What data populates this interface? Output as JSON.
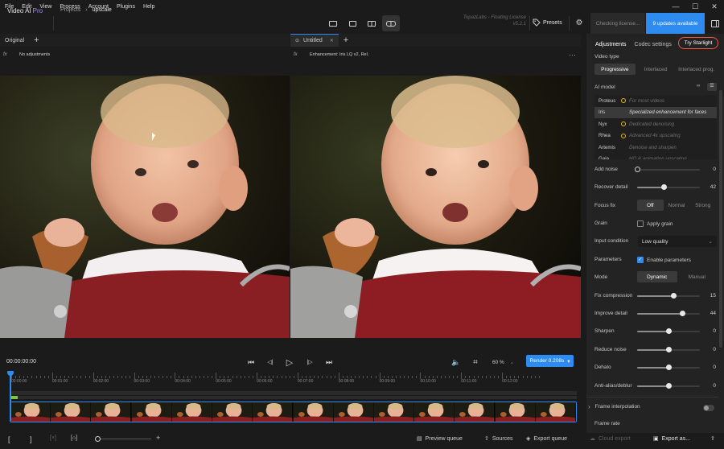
{
  "menu": [
    "File",
    "Edit",
    "View",
    "Process",
    "Account",
    "Plugins",
    "Help"
  ],
  "window_controls": {
    "minimize": "—",
    "maximize": "☐",
    "close": "✕"
  },
  "app": {
    "name": "Video AI",
    "edition": "Pro"
  },
  "breadcrumb": {
    "root": "Projects",
    "sep": "›",
    "current": "upscale"
  },
  "license": {
    "line1": "TopazLabs - Floating License",
    "line2": "v5.2.1"
  },
  "toolbar": {
    "presets_label": "Presets",
    "checking_label": "Checking license...",
    "updates_label": "9 updates available"
  },
  "left_preview": {
    "tab_label": "Original",
    "plus": "+",
    "fx_icon": "fx",
    "subtitle": "No adjustments"
  },
  "right_preview": {
    "tab_label": "Untitled",
    "close": "✕",
    "plus": "+",
    "fx_icon": "fx",
    "subtitle": "Enhancement: Iris LQ v2, Rel.",
    "more": "···"
  },
  "player": {
    "timecode": "00:00:00:00",
    "zoom": "60 %",
    "zoom_caret": "⌄",
    "render_label": "Render 0.208s",
    "render_caret": "▾",
    "icons": {
      "skip_back": "⏮",
      "step_back": "◁|",
      "play": "▷",
      "step_fwd": "|▷",
      "skip_fwd": "⏭",
      "volume": "🔈",
      "crop": "⌗"
    }
  },
  "timeline": {
    "ticks": [
      "00:00:00",
      "00:01:00",
      "00:02:00",
      "00:03:00",
      "00:04:00",
      "00:05:00",
      "00:06:00",
      "00:07:00",
      "00:08:00",
      "00:09:00",
      "00:10:00",
      "00:11:00",
      "00:12:00"
    ],
    "frame_count": 14,
    "progress": 0.014
  },
  "bottombar": {
    "bracket_in": "[",
    "bracket_out": "]",
    "plus": "+",
    "preview_queue": "Preview queue",
    "sources": "Sources",
    "export_queue": "Export queue",
    "cloud_export": "Cloud export",
    "export_as": "Export as...",
    "share": "⇪"
  },
  "panel": {
    "tabs": [
      "Adjustments",
      "Codec settings"
    ],
    "starlight_label": "Try Starlight",
    "video_type": {
      "label": "Video type",
      "options": [
        "Progressive",
        "Interlaced",
        "Interlaced prog."
      ],
      "selected": 0
    },
    "ai_model": {
      "label": "AI model",
      "models": [
        {
          "name": "Proteus",
          "desc": "For most videos",
          "dot": true
        },
        {
          "name": "Iris",
          "desc": "Specialized enhancement for faces",
          "dot": false
        },
        {
          "name": "Nyx",
          "desc": "Dedicated denoising",
          "dot": true
        },
        {
          "name": "Rhea",
          "desc": "Advanced 4x upscaling",
          "dot": true
        },
        {
          "name": "Artemis",
          "desc": "Denoise and sharpen",
          "dot": false
        },
        {
          "name": "Gaia",
          "desc": "HQ & animation upscaling",
          "dot": false
        }
      ],
      "selected": 1
    },
    "add_noise": {
      "label": "Add noise",
      "value": "0",
      "fraction": 0.0
    },
    "recover_detail": {
      "label": "Recover detail",
      "value": "42",
      "fraction": 0.42
    },
    "focus_fix": {
      "label": "Focus fix",
      "options": [
        "Off",
        "Normal",
        "Strong"
      ],
      "selected": 0
    },
    "grain": {
      "label": "Grain",
      "checkbox_label": "Apply grain",
      "checked": false
    },
    "input_condition": {
      "label": "Input condition",
      "value": "Low quality",
      "caret": "⌄"
    },
    "parameters": {
      "label": "Parameters",
      "checkbox_label": "Enable parameters",
      "checked": true,
      "check": "✓"
    },
    "mode": {
      "label": "Mode",
      "options": [
        "Dynamic",
        "Manual"
      ],
      "selected": 0
    },
    "fix_compression": {
      "label": "Fix compression",
      "value": "15",
      "fraction": 0.58
    },
    "improve_detail": {
      "label": "Improve detail",
      "value": "44",
      "fraction": 0.72
    },
    "sharpen": {
      "label": "Sharpen",
      "value": "0",
      "fraction": 0.5
    },
    "reduce_noise": {
      "label": "Reduce noise",
      "value": "0",
      "fraction": 0.5
    },
    "dehalo": {
      "label": "Dehalo",
      "value": "0",
      "fraction": 0.5
    },
    "anti_alias": {
      "label": "Anti-alias/deblur",
      "value": "0",
      "fraction": 0.5
    },
    "frame_interpolation": {
      "label": "Frame interpolation",
      "chevron": "›",
      "enabled": false
    },
    "frame_rate": {
      "label": "Frame rate"
    }
  },
  "colors": {
    "accent": "#2e8bf0",
    "starlight_border": "#f05a4a",
    "model_dot": "#e8b70a",
    "progress": "#7ac943"
  }
}
